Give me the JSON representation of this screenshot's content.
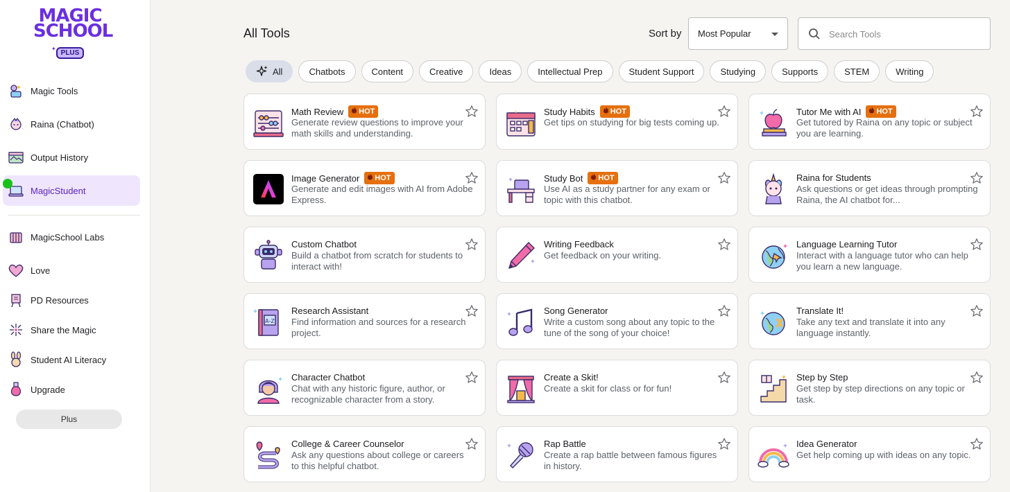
{
  "logo": {
    "line1": "MAGIC",
    "line2": "SCHOOL",
    "badge": "PLUS"
  },
  "sidebar": {
    "items": [
      {
        "label": "Magic Tools",
        "icon": "magic-tools-icon"
      },
      {
        "label": "Raina (Chatbot)",
        "icon": "raina-icon"
      },
      {
        "label": "Output History",
        "icon": "output-history-icon"
      },
      {
        "label": "MagicStudent",
        "icon": "magic-student-icon",
        "active": true
      },
      {
        "label": "MagicSchool Labs",
        "icon": "labs-icon"
      },
      {
        "label": "Love",
        "icon": "heart-icon"
      },
      {
        "label": "PD Resources",
        "icon": "pd-resources-icon"
      },
      {
        "label": "Share the Magic",
        "icon": "share-icon"
      },
      {
        "label": "Student AI Literacy",
        "icon": "bunny-icon"
      },
      {
        "label": "Upgrade",
        "icon": "potion-icon"
      }
    ],
    "plus_button": "Plus"
  },
  "header": {
    "title": "All Tools",
    "sort_label": "Sort by",
    "sort_value": "Most Popular",
    "search_placeholder": "Search Tools"
  },
  "filters": [
    "All",
    "Chatbots",
    "Content",
    "Creative",
    "Ideas",
    "Intellectual Prep",
    "Student Support",
    "Studying",
    "Supports",
    "STEM",
    "Writing"
  ],
  "hot_label": "HOT",
  "cards": [
    {
      "title": "Math Review",
      "hot": true,
      "desc": "Generate review questions to improve your math skills and understanding.",
      "icon": "abacus-icon"
    },
    {
      "title": "Study Habits",
      "hot": true,
      "desc": "Get tips on studying for big tests coming up.",
      "icon": "calendar-icon"
    },
    {
      "title": "Tutor Me with AI",
      "hot": true,
      "desc": "Get tutored by Raina on any topic or subject you are learning.",
      "icon": "apple-books-icon"
    },
    {
      "title": "Image Generator",
      "hot": true,
      "desc": "Generate and edit images with AI from Adobe Express.",
      "icon": "adobe-express-icon"
    },
    {
      "title": "Study Bot",
      "hot": true,
      "desc": "Use AI as a study partner for any exam or topic with this chatbot.",
      "icon": "desk-icon"
    },
    {
      "title": "Raina for Students",
      "hot": false,
      "desc": "Ask questions or get ideas through prompting Raina, the AI chatbot for...",
      "icon": "unicorn-icon"
    },
    {
      "title": "Custom Chatbot",
      "hot": false,
      "desc": "Build a chatbot from scratch for students to interact with!",
      "icon": "robot-icon"
    },
    {
      "title": "Writing Feedback",
      "hot": false,
      "desc": "Get feedback on your writing.",
      "icon": "pen-icon"
    },
    {
      "title": "Language Learning Tutor",
      "hot": false,
      "desc": "Interact with a language tutor who can help you learn a new language.",
      "icon": "globe-plane-icon"
    },
    {
      "title": "Research Assistant",
      "hot": false,
      "desc": "Find information and sources for a research project.",
      "icon": "dictionary-icon"
    },
    {
      "title": "Song Generator",
      "hot": false,
      "desc": "Write a custom song about any topic to the tune of the song of your choice!",
      "icon": "music-note-icon"
    },
    {
      "title": "Translate It!",
      "hot": false,
      "desc": "Take any text and translate it into any language instantly.",
      "icon": "globe-translate-icon"
    },
    {
      "title": "Character Chatbot",
      "hot": false,
      "desc": "Chat with any historic figure, author, or recognizable character from a story.",
      "icon": "character-icon"
    },
    {
      "title": "Create a Skit!",
      "hot": false,
      "desc": "Create a skit for class or for fun!",
      "icon": "theater-icon"
    },
    {
      "title": "Step by Step",
      "hot": false,
      "desc": "Get step by step directions on any topic or task.",
      "icon": "stairs-icon"
    },
    {
      "title": "College & Career Counselor",
      "hot": false,
      "desc": "Ask any questions about college or careers to this helpful chatbot.",
      "icon": "road-map-icon"
    },
    {
      "title": "Rap Battle",
      "hot": false,
      "desc": "Create a rap battle between famous figures in history.",
      "icon": "microphone-icon"
    },
    {
      "title": "Idea Generator",
      "hot": false,
      "desc": "Get help coming up with ideas on any topic.",
      "icon": "rainbow-icon"
    }
  ],
  "colors": {
    "accent": "#6b2fe0",
    "active_bg": "#efe6fd",
    "hot": "#e66f0e",
    "chip_active": "#d9dee9"
  }
}
